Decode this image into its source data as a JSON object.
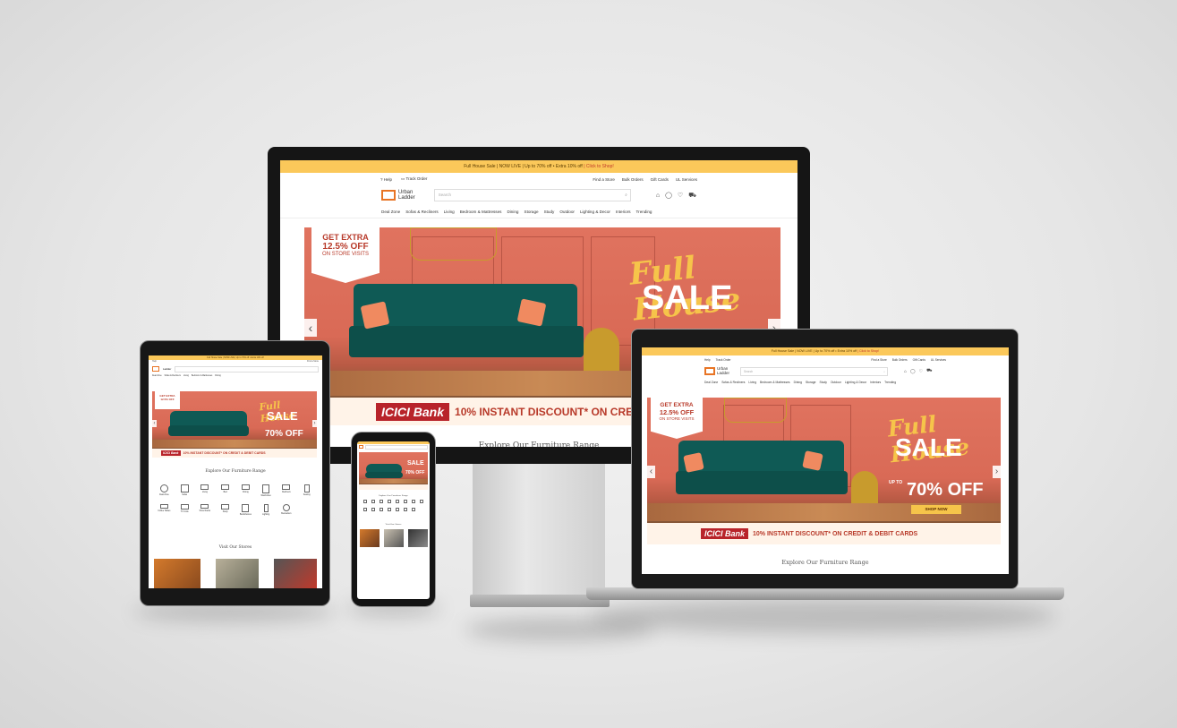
{
  "site": {
    "announcement": "Full House Sale | NOW LIVE | Up to 70% off • Extra 10% off",
    "announcement_cta": "| Click to Shop!",
    "help": "Help",
    "track_order": "Track Order",
    "top_links": [
      "Find a Store",
      "Bulk Orders",
      "Gift Cards",
      "UL Services"
    ],
    "logo_line1": "Urban",
    "logo_line2": "Ladder",
    "search_placeholder": "Search",
    "wishlist_count": "0",
    "cart_count": "0",
    "nav": [
      "Deal Zone",
      "Sofas & Recliners",
      "Living",
      "Bedroom & Mattresses",
      "Dining",
      "Storage",
      "Study",
      "Outdoor",
      "Lighting & Decor",
      "Interiors",
      "Trending"
    ],
    "nav_laptop": [
      "Deal Zone",
      "Sofas & Recliners",
      "Living",
      "Bedroom & Mattresses",
      "Dining",
      "Storage",
      "Study",
      "Outdoor",
      "Lighting & Decor",
      "Interiors",
      "Trending"
    ]
  },
  "hero": {
    "badge_line1": "GET EXTRA",
    "badge_line2": "12.5% OFF",
    "badge_line3": "ON STORE VISITS",
    "script_title": "Full House",
    "sale": "SALE",
    "upto": "UP TO",
    "discount": "70% OFF",
    "shop_now": "SHOP NOW",
    "bank_name": "ICICI Bank",
    "bank_offer": "10% INSTANT DISCOUNT* ON CREDIT & DEBIT CARDS",
    "bank_offer_cut": "10% INSTANT DISCOUNT* ON CRE"
  },
  "sections": {
    "explore": "Explore Our Furniture Range",
    "visit": "Visit Our Stores"
  },
  "categories": [
    "Deal Zone",
    "Sofas",
    "Living",
    "Bed",
    "Dining",
    "Wardrobes",
    "Recliners",
    "Seating",
    "Coffee Tables",
    "TV Units",
    "Shoe Racks",
    "Study",
    "Bookshelves",
    "Lighting",
    "Bestsellers"
  ],
  "icons": {
    "prev": "‹",
    "next": "›"
  },
  "colors": {
    "accent": "#e87424",
    "announcement_bg": "#fbc85a",
    "hero_bg": "#d96a56",
    "sofa": "#0f5a55",
    "script_gold": "#f6c44a",
    "bank_red": "#b8232a"
  }
}
